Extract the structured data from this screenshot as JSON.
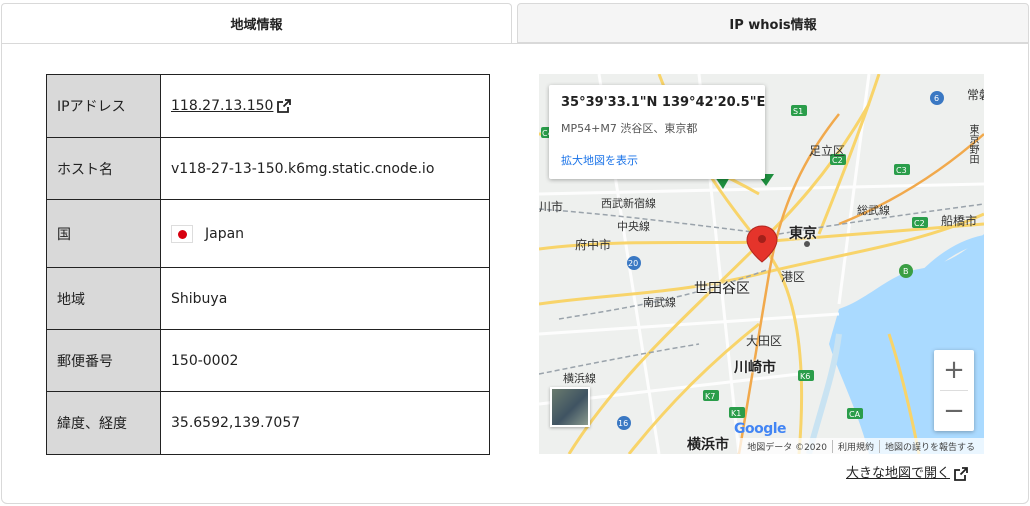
{
  "tabs": [
    {
      "label": "地域情報",
      "active": true
    },
    {
      "label": "IP whois情報",
      "active": false
    }
  ],
  "info": {
    "rows": [
      {
        "key": "IPアドレス",
        "value": "118.27.13.150"
      },
      {
        "key": "ホスト名",
        "value": "v118-27-13-150.k6mg.static.cnode.io"
      },
      {
        "key": "国",
        "value": "Japan"
      },
      {
        "key": "地域",
        "value": "Shibuya"
      },
      {
        "key": "郵便番号",
        "value": "150-0002"
      },
      {
        "key": "緯度、経度",
        "value": "35.6592,139.7057"
      }
    ]
  },
  "map": {
    "popup": {
      "coord": "35°39'33.1\"N 139°42'20.5\"E",
      "address": "MP54+M7 渋谷区、東京都",
      "link": "拡大地図を表示"
    },
    "labels": {
      "adachi": "足立区",
      "tokyo": "東京",
      "minato": "港区",
      "setagaya": "世田谷区",
      "ota": "大田区",
      "kawasaki": "川崎市",
      "yokohama": "横浜市",
      "fuchu": "府中市",
      "seibu": "西武新宿線",
      "chuo": "中央線",
      "nambu": "南武線",
      "sobu": "総武線",
      "funabashi": "船橋市",
      "yokohama_line": "横浜線",
      "joban": "常磐",
      "keiyo": "東京野田",
      "ichikawa": "川市"
    },
    "zoom_in": "+",
    "zoom_out": "−",
    "google": "Google",
    "attribution": [
      "地図データ ©2020",
      "利用規約",
      "地図の誤りを報告する"
    ],
    "open_link": "大きな地図で開く"
  },
  "colors": {
    "pin": "#e5342b",
    "water": "#aadaff",
    "road": "#f8d46a"
  }
}
